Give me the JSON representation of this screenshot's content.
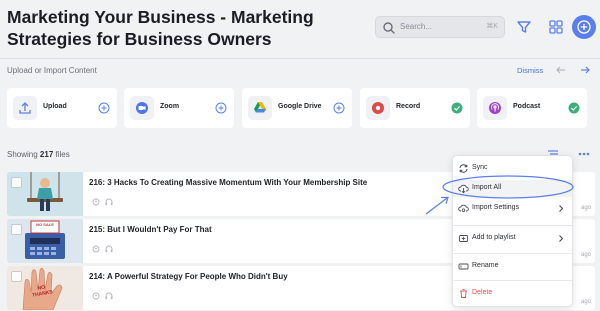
{
  "header": {
    "title": "Marketing Your Business - Marketing Strategies for Business Owners",
    "search_placeholder": "Search...",
    "search_shortcut": "⌘K",
    "icons": [
      "search-icon",
      "filter-icon",
      "grid-icon",
      "plus-icon"
    ]
  },
  "upload_section": {
    "title": "Upload or Import Content",
    "dismiss_label": "Dismiss",
    "sources": [
      {
        "label": "Upload",
        "icon": "upload-icon",
        "status": "add"
      },
      {
        "label": "Zoom",
        "icon": "zoom-icon",
        "status": "add"
      },
      {
        "label": "Google Drive",
        "icon": "google-drive-icon",
        "status": "add"
      },
      {
        "label": "Record",
        "icon": "record-icon",
        "status": "connected"
      },
      {
        "label": "Podcast",
        "icon": "podcast-icon",
        "status": "connected"
      }
    ]
  },
  "files": {
    "showing_label": "Showing",
    "count": "217",
    "count_suffix": "files",
    "items": [
      {
        "title": "216: 3 Hacks To Creating Massive Momentum With Your Membership Site",
        "ago": "ago"
      },
      {
        "title": "215: But I Wouldn't Pay For That",
        "ago": "ago"
      },
      {
        "title": "214: A Powerful Strategy For People Who Didn't Buy",
        "ago": "ago"
      }
    ],
    "thumb_texts": [
      "NO SALE",
      "NO THANKS"
    ]
  },
  "context_menu": {
    "items": [
      {
        "label": "Sync",
        "icon": "sync-icon"
      },
      {
        "label": "Import All",
        "icon": "cloud-download-icon"
      },
      {
        "label": "Import Settings",
        "icon": "settings-icon"
      },
      {
        "label": "Add to playlist",
        "icon": "playlist-icon"
      },
      {
        "label": "Rename",
        "icon": "rename-icon"
      },
      {
        "label": "Delete",
        "icon": "trash-icon"
      }
    ]
  },
  "colors": {
    "accent": "#5b7fe8",
    "connected": "#3fae7a",
    "delete": "#e0504b",
    "annotation": "#5b7fe8",
    "record": "#e04848",
    "podcast": "#a23fc9"
  }
}
